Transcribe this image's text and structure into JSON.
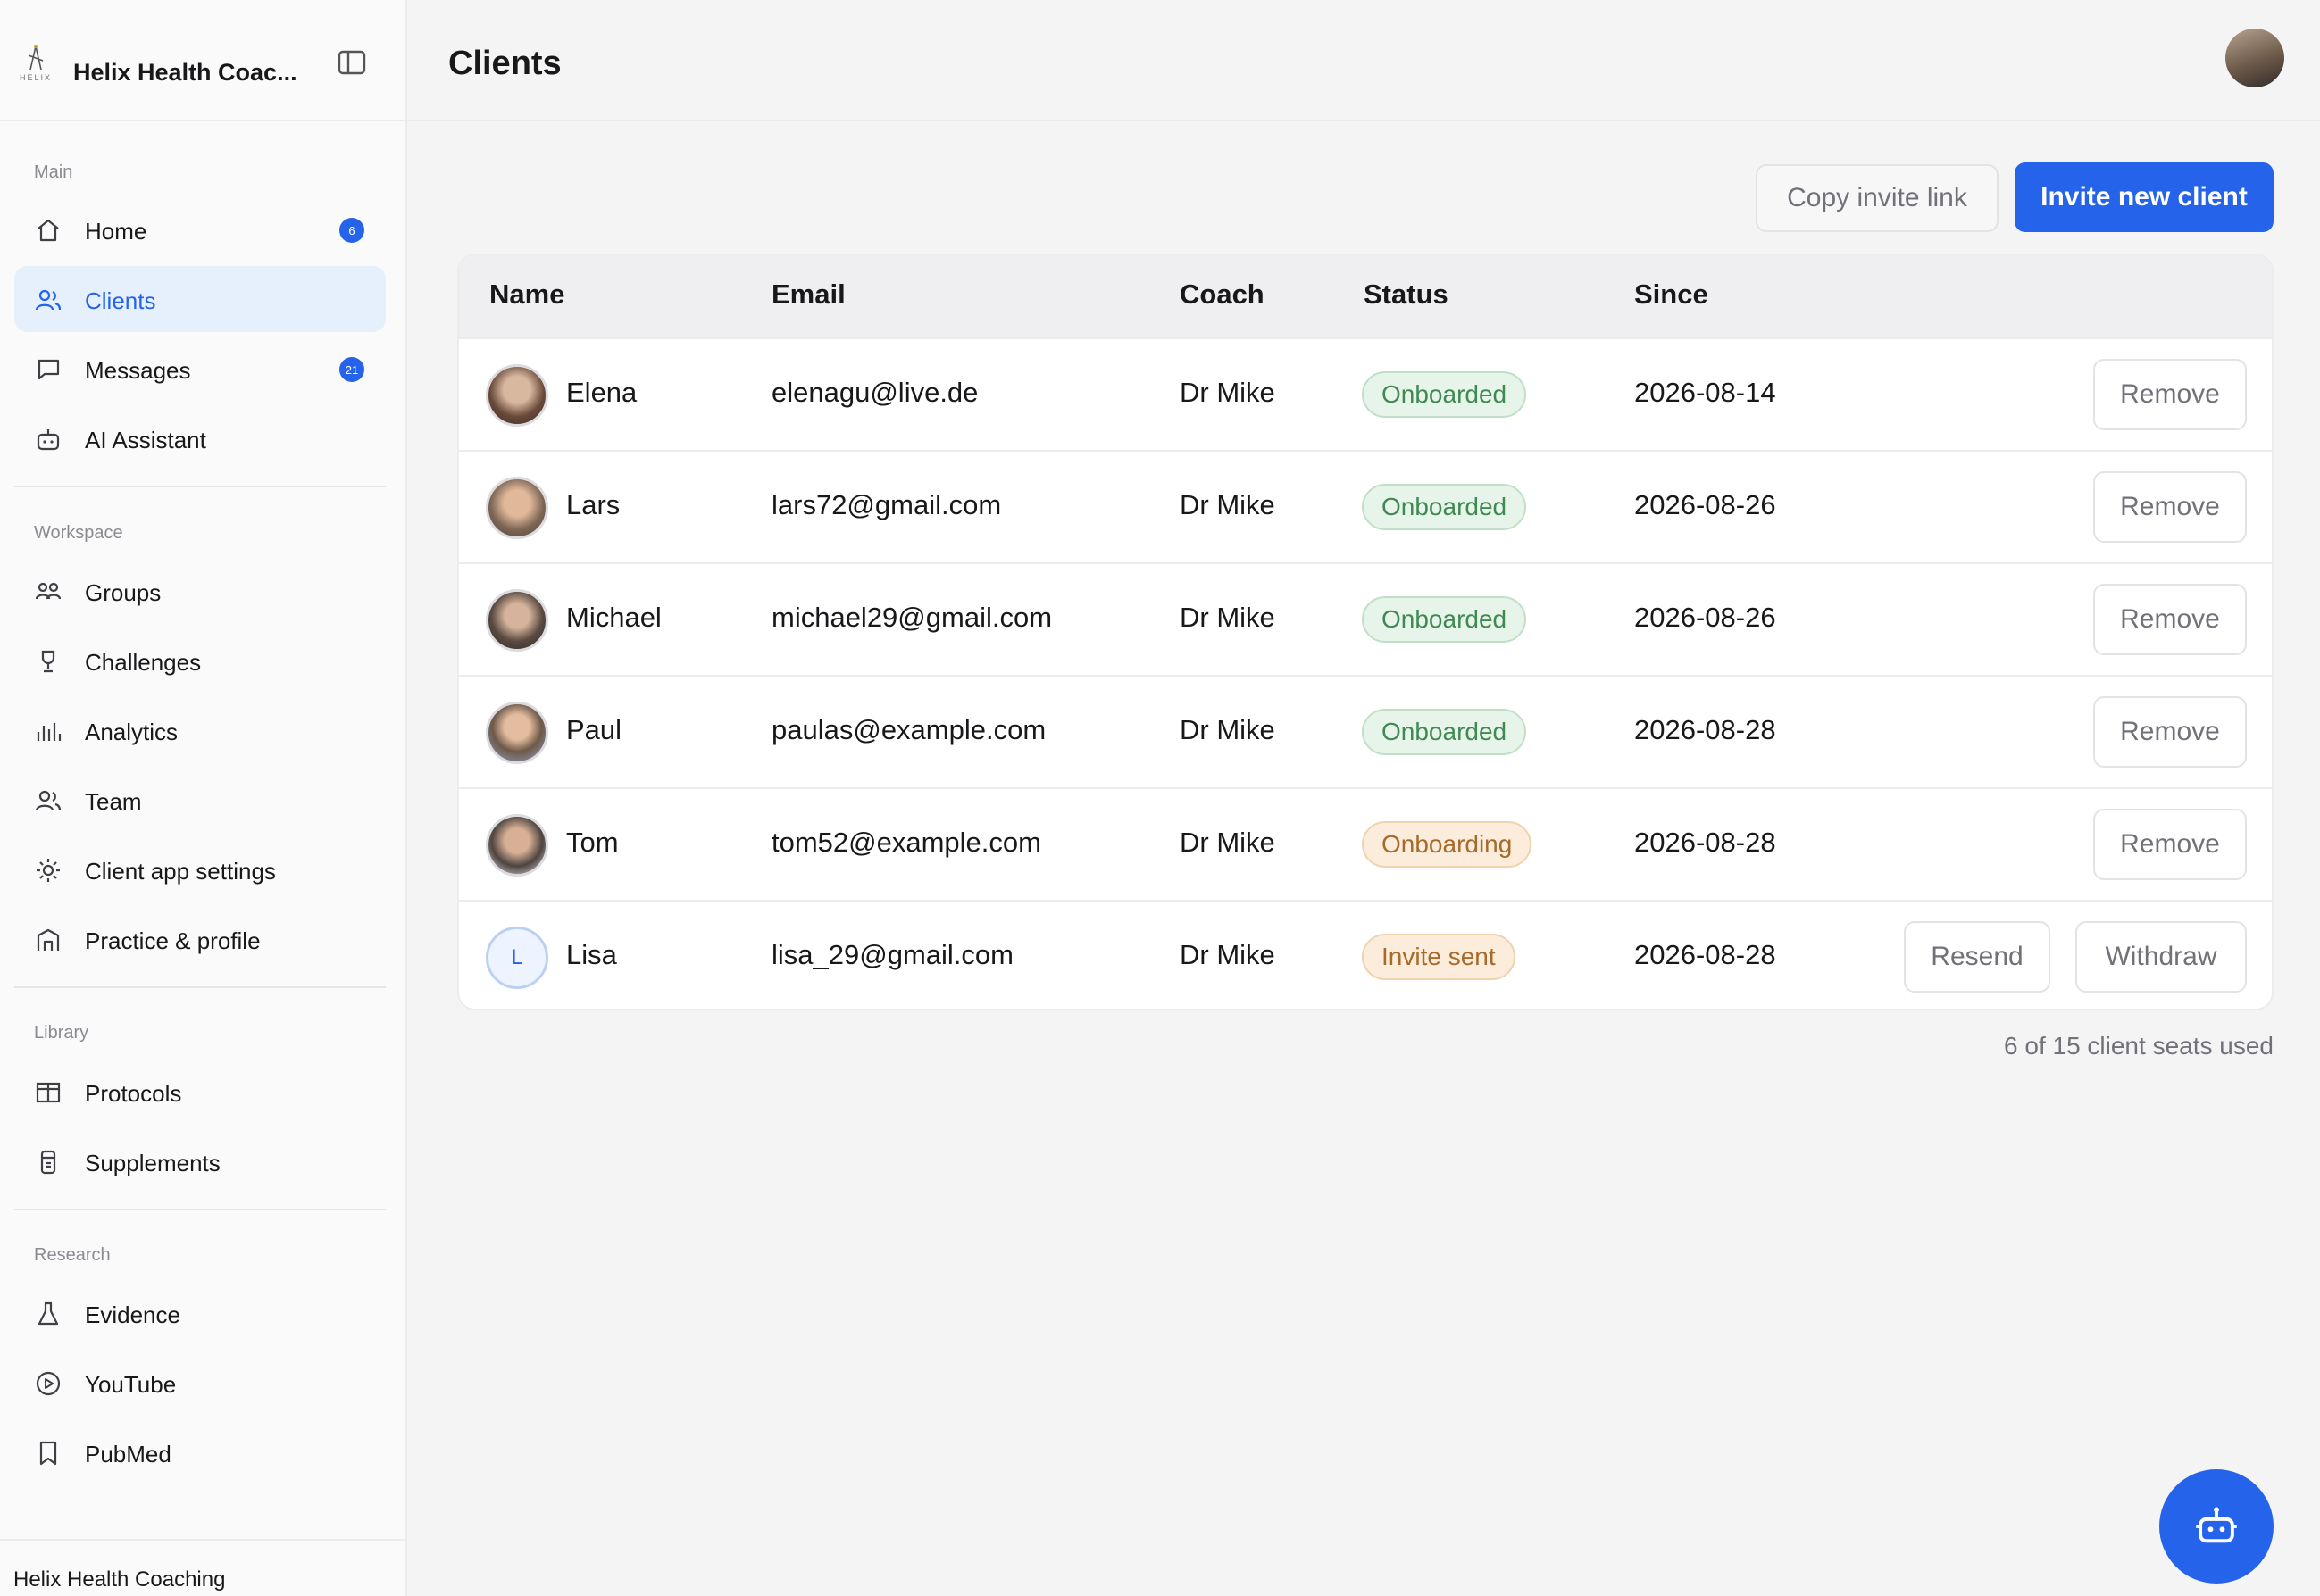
{
  "brand": {
    "name": "Helix Health Coac...",
    "logo_text": "HELIX",
    "footer_name": "Helix Health Coaching"
  },
  "sidebar": {
    "sections": [
      {
        "label": "Main",
        "items": [
          {
            "label": "Home",
            "icon": "home-icon",
            "badge": "6"
          },
          {
            "label": "Clients",
            "icon": "users-icon",
            "active": true
          },
          {
            "label": "Messages",
            "icon": "message-icon",
            "badge": "21"
          },
          {
            "label": "AI Assistant",
            "icon": "bot-icon"
          }
        ]
      },
      {
        "label": "Workspace",
        "items": [
          {
            "label": "Groups",
            "icon": "groups-icon"
          },
          {
            "label": "Challenges",
            "icon": "trophy-icon"
          },
          {
            "label": "Analytics",
            "icon": "bar-chart-icon"
          },
          {
            "label": "Team",
            "icon": "team-icon"
          },
          {
            "label": "Client app settings",
            "icon": "settings-sun-icon"
          },
          {
            "label": "Practice & profile",
            "icon": "building-icon"
          }
        ]
      },
      {
        "label": "Library",
        "items": [
          {
            "label": "Protocols",
            "icon": "protocols-icon"
          },
          {
            "label": "Supplements",
            "icon": "supplement-icon"
          }
        ]
      },
      {
        "label": "Research",
        "items": [
          {
            "label": "Evidence",
            "icon": "flask-icon"
          },
          {
            "label": "YouTube",
            "icon": "play-circle-icon"
          },
          {
            "label": "PubMed",
            "icon": "bookmark-icon"
          }
        ]
      }
    ]
  },
  "header": {
    "title": "Clients"
  },
  "actions": {
    "copy_invite": "Copy invite link",
    "invite_new": "Invite new client"
  },
  "table": {
    "columns": {
      "name": "Name",
      "email": "Email",
      "coach": "Coach",
      "status": "Status",
      "since": "Since"
    },
    "rows": [
      {
        "name": "Elena",
        "email": "elenagu@live.de",
        "coach": "Dr Mike",
        "status": "Onboarded",
        "since": "2026-08-14",
        "actions": [
          "Remove"
        ]
      },
      {
        "name": "Lars",
        "email": "lars72@gmail.com",
        "coach": "Dr Mike",
        "status": "Onboarded",
        "since": "2026-08-26",
        "actions": [
          "Remove"
        ]
      },
      {
        "name": "Michael",
        "email": "michael29@gmail.com",
        "coach": "Dr Mike",
        "status": "Onboarded",
        "since": "2026-08-26",
        "actions": [
          "Remove"
        ]
      },
      {
        "name": "Paul",
        "email": "paulas@example.com",
        "coach": "Dr Mike",
        "status": "Onboarded",
        "since": "2026-08-28",
        "actions": [
          "Remove"
        ]
      },
      {
        "name": "Tom",
        "email": "tom52@example.com",
        "coach": "Dr Mike",
        "status": "Onboarding",
        "since": "2026-08-28",
        "actions": [
          "Remove"
        ]
      },
      {
        "name": "Lisa",
        "email": "lisa_29@gmail.com",
        "coach": "Dr Mike",
        "status": "Invite sent",
        "since": "2026-08-28",
        "initial": "L",
        "actions": [
          "Resend",
          "Withdraw"
        ]
      }
    ]
  },
  "seats": {
    "text": "6 of 15 client seats used"
  },
  "colors": {
    "accent": "#2563eb",
    "success": "#3f8a52",
    "warning": "#a86a2a"
  }
}
